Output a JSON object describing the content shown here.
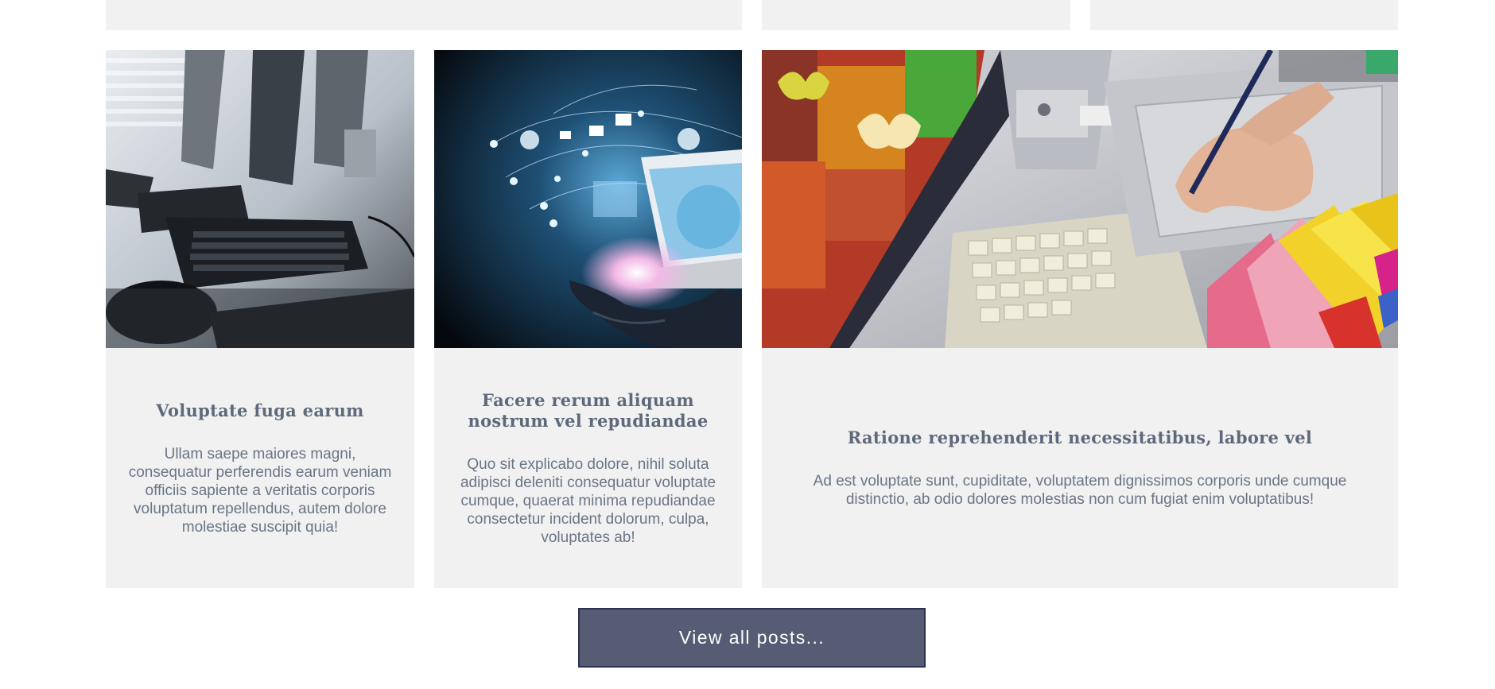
{
  "posts": [
    {
      "title": "Voluptate fuga earum",
      "excerpt": "Ullam saepe maiores magni, consequatur perferendis earum veniam officiis sapiente a veritatis corporis voluptatum repellendus, autem dolore molestiae suscipit quia!",
      "image": "office-keyboards-photo"
    },
    {
      "title": "Facere rerum aliquam nostrum vel repudiandae",
      "excerpt": "Quo sit explicabo dolore, nihil soluta adipisci deleniti consequatur voluptate cumque, quaerat minima repudiandae consectetur incident dolorum, culpa, voluptates ab!",
      "image": "digital-network-laptop-photo"
    },
    {
      "title": "Ratione reprehenderit necessitatibus, labore vel",
      "excerpt": "Ad est voluptate sunt, cupiditate, voluptatem dignissimos corporis unde cumque distinctio, ab odio dolores molestias non cum fugiat enim voluptatibus!",
      "image": "designer-drawing-tablet-photo"
    }
  ],
  "view_all_label": "View all posts...",
  "colors": {
    "card_bg": "#f1f1f1",
    "heading": "#5e6a7c",
    "body_text": "#6a7585",
    "button_bg": "#575c75",
    "button_border": "#2c3150",
    "button_text": "#ffffff"
  }
}
